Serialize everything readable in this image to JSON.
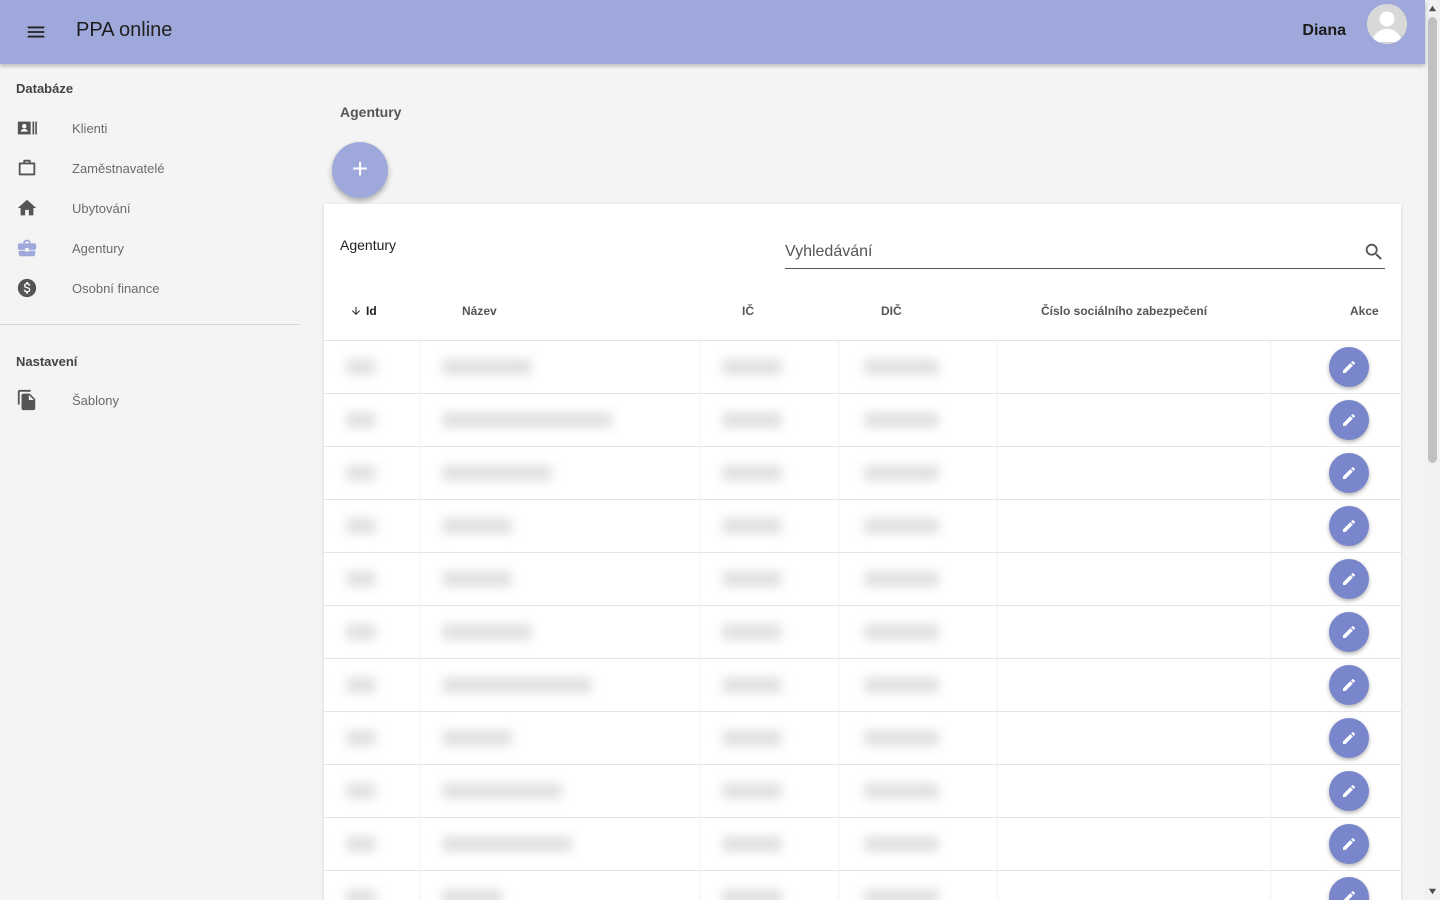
{
  "header": {
    "app_name_bold": "PPA",
    "app_name_light": "online",
    "user_name": "Diana"
  },
  "sidebar": {
    "section_database": "Databáze",
    "section_settings": "Nastavení",
    "items": [
      {
        "label": "Klienti",
        "icon": "contact-card-icon"
      },
      {
        "label": "Zaměstnavatelé",
        "icon": "briefcase-outline-icon"
      },
      {
        "label": "Ubytování",
        "icon": "home-icon"
      },
      {
        "label": "Agentury",
        "icon": "business-center-icon",
        "active": true
      },
      {
        "label": "Osobní finance",
        "icon": "dollar-circle-icon"
      }
    ],
    "settings_items": [
      {
        "label": "Šablony",
        "icon": "file-copy-icon"
      }
    ]
  },
  "main": {
    "page_heading": "Agentury",
    "card_title": "Agentury",
    "search_placeholder": "Vyhledávání",
    "columns": {
      "id": "Id",
      "name": "Název",
      "ic": "IČ",
      "dic": "DIČ",
      "social": "Číslo sociálního zabezpečení",
      "actions": "Akce"
    },
    "sort": {
      "column": "id",
      "direction": "ascending"
    },
    "row_count_visible": 11
  },
  "colors": {
    "header_bg": "#9fa8da",
    "accent": "#7986cb",
    "page_bg": "#f4f4f4",
    "active_icon": "#9fa8da"
  }
}
